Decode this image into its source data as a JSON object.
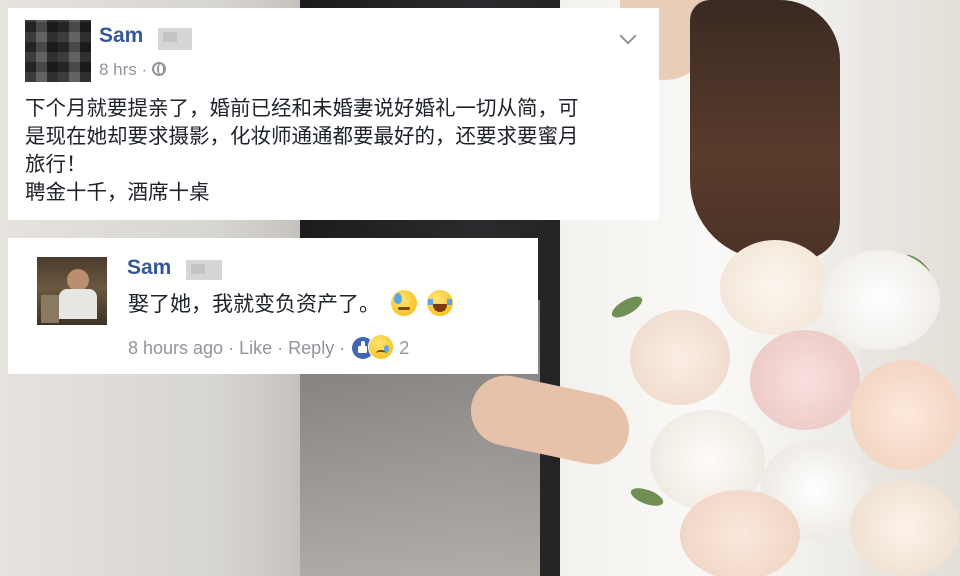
{
  "post": {
    "author": "Sam",
    "time": "8 hrs",
    "separator": "·",
    "lines": [
      "下个月就要提亲了，婚前已经和未婚妻说好婚礼一切从简，可",
      "是现在她却要求摄影，化妆师通通都要最好的，还要求要蜜月",
      "旅行！",
      "聘金十千，酒席十桌"
    ]
  },
  "comment": {
    "author": "Sam",
    "text": "娶了她，我就变负资产了。",
    "time": "8 hours ago",
    "sep": "·",
    "like": "Like",
    "reply": "Reply",
    "reaction_count": "2",
    "emojis": [
      "sweat-emoji",
      "laughing-tears-emoji"
    ]
  },
  "colors": {
    "name_blue": "#365899",
    "meta_gray": "#90949c",
    "like_blue": "#4267b2"
  }
}
